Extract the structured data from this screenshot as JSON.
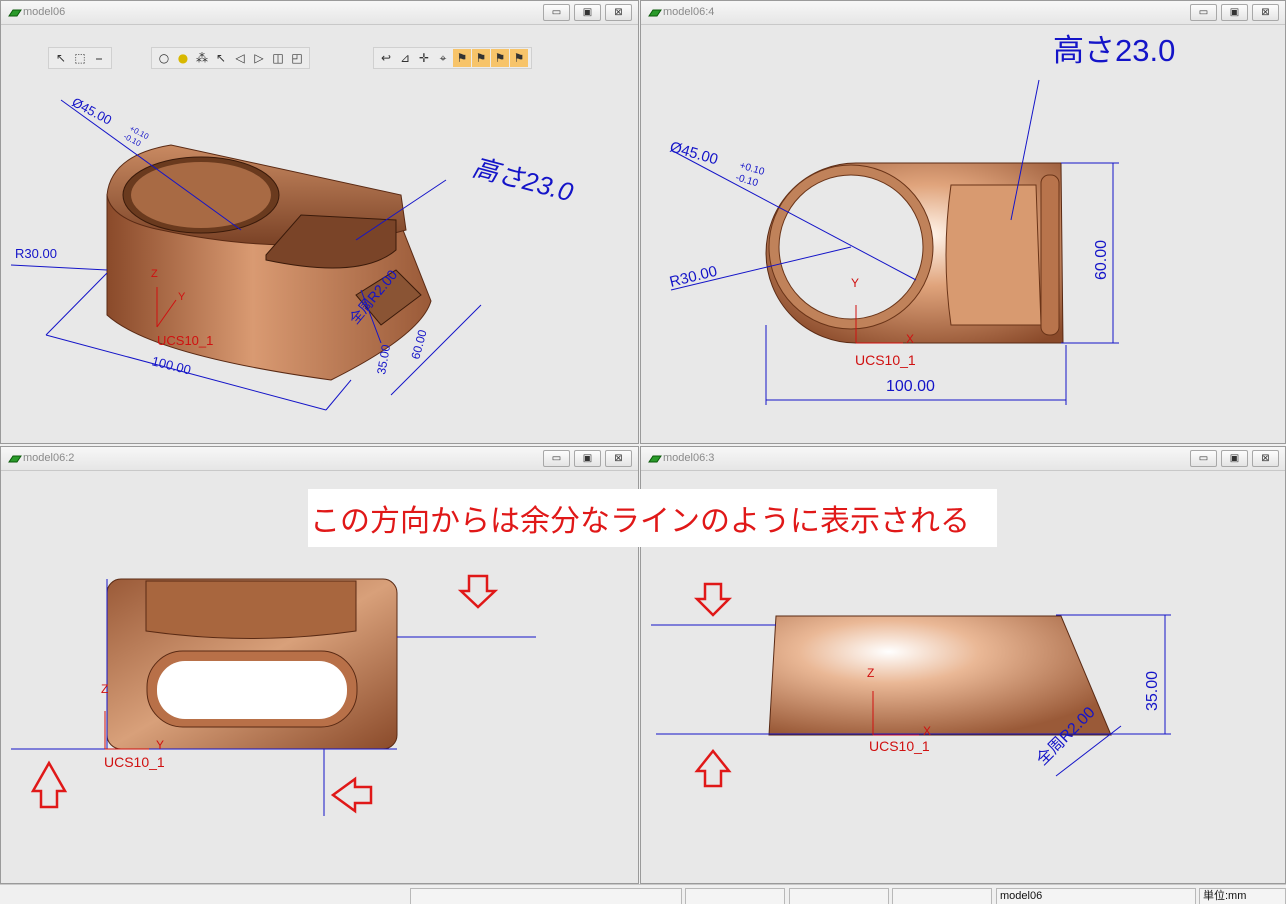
{
  "viewports": [
    {
      "id": "iso",
      "title": "model06"
    },
    {
      "id": "top",
      "title": "model06:4"
    },
    {
      "id": "side",
      "title": "model06:2"
    },
    {
      "id": "front",
      "title": "model06:3"
    }
  ],
  "window_buttons": {
    "minimize": "▭",
    "restore": "▣",
    "close": "⊠"
  },
  "dims": {
    "diameter_main": "Ø45.00",
    "tol_plus": "+0.10",
    "tol_minus": "-0.10",
    "height_note": "高さ23.0",
    "radius": "R30.00",
    "length": "100.00",
    "width": "60.00",
    "height": "35.00",
    "fillet": "全周R2.00"
  },
  "ucs": {
    "label": "UCS10_1",
    "x": "X",
    "y": "Y",
    "z": "Z"
  },
  "callout": "この方向からは余分なラインのように表示される",
  "statusbar": {
    "model": "model06",
    "unit": "単位:mm"
  },
  "toolbar_icons": [
    "select-x-icon",
    "box-select-icon",
    "line-dropdown-icon",
    "bulb-icon",
    "bulb-on-icon",
    "bulb-group-icon",
    "arrow-select-icon",
    "nav-left-icon",
    "nav-right-icon",
    "cube-view-icon",
    "cube-mode-icon",
    "undo-icon",
    "filter-icon",
    "snap-icon",
    "snap2-icon",
    "flag1-icon",
    "flag2-icon",
    "flag3-icon",
    "flag4-icon"
  ],
  "colors": {
    "dim": "#1414c8",
    "ucs": "#d01010",
    "copper": "#b8704a",
    "callout": "#e01818"
  }
}
